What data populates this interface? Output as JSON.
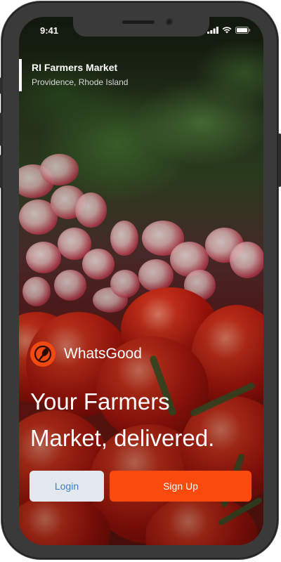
{
  "status_bar": {
    "time": "9:41"
  },
  "market": {
    "name": "RI Farmers Market",
    "location": "Providence, Rhode Island"
  },
  "brand": {
    "name": "WhatsGood",
    "logo_icon": "fork-plate-icon",
    "color": "#f04a12"
  },
  "hero": {
    "line1": "Your Farmers",
    "line2": "Market, delivered."
  },
  "actions": {
    "login_label": "Login",
    "signup_label": "Sign Up",
    "signup_color": "#fa4a0d",
    "login_color": "#e3e8ee"
  }
}
